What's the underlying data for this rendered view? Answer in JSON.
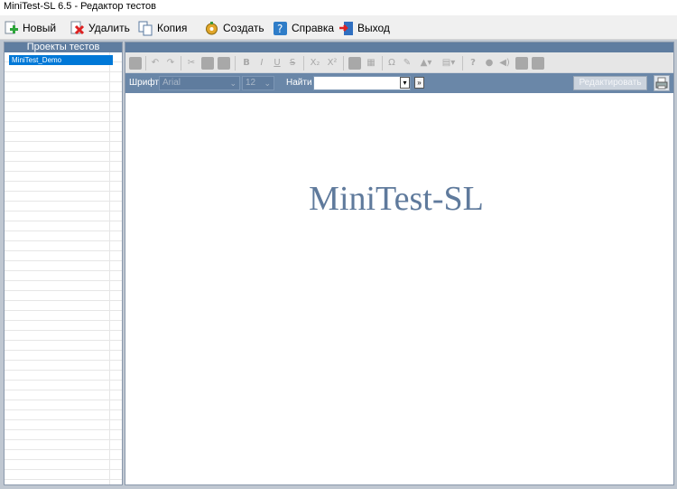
{
  "window": {
    "title": "MiniTest-SL 6.5 - Редактор тестов"
  },
  "menubar": {
    "items": [
      {
        "label": "Новый",
        "icon": "new-plus-icon"
      },
      {
        "label": "Удалить",
        "icon": "delete-x-icon"
      },
      {
        "label": "Копия",
        "icon": "copy-icon"
      },
      {
        "label": "Создать",
        "icon": "create-gear-icon"
      },
      {
        "label": "Справка",
        "icon": "help-question-icon"
      },
      {
        "label": "Выход",
        "icon": "exit-door-icon"
      }
    ]
  },
  "left_panel": {
    "header": "Проекты тестов",
    "projects": [
      "MiniTest_Demo"
    ],
    "selected_project": "MiniTest_Demo"
  },
  "format_toolbar": {
    "buttons": [
      "save-icon",
      "undo-icon",
      "redo-icon",
      "cut-icon",
      "copy-icon",
      "paste-icon",
      "bold-icon",
      "italic-icon",
      "underline-icon",
      "strike-icon",
      "subscript-icon",
      "superscript-icon",
      "format-paint-icon",
      "table-grid-icon",
      "omega-icon",
      "pencil-icon",
      "fill-color-icon",
      "border-icon",
      "help-icon",
      "bulb-icon",
      "sound-icon",
      "image-icon",
      "save2-icon"
    ],
    "bold": "B",
    "italic": "I",
    "underline": "U",
    "strike": "S",
    "subscript": "X₂",
    "superscript": "X²",
    "omega": "Ω",
    "help": "?"
  },
  "toolbar2": {
    "font_label": "Шрифт",
    "font_value": "Arial",
    "size_value": "12",
    "find_label": "Найти",
    "find_value": "",
    "edit_button": "Редактировать"
  },
  "editor": {
    "logo_text": "MiniTest-SL"
  },
  "colors": {
    "accent": "#5f7da0",
    "toolbar2": "#6a87a8",
    "logo": "#5f7a9c",
    "selection": "#0078d7"
  }
}
